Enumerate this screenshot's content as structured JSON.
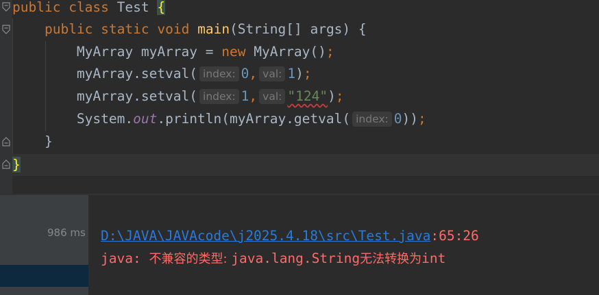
{
  "editor": {
    "line1": {
      "kw1": "public",
      "kw2": "class",
      "name": "Test",
      "brace": "{"
    },
    "line2": {
      "kw1": "public",
      "kw2": "static",
      "kw3": "void",
      "method": "main",
      "params": "(String[] args) {"
    },
    "line3": {
      "type": "MyArray myArray = ",
      "kw": "new",
      "ctor": " MyArray()",
      "semi": ";"
    },
    "line4": {
      "call": "myArray.setval(",
      "hint_index": "index:",
      "arg1": "0",
      "comma": ",",
      "hint_val": "val:",
      "arg2": "1",
      "close": ")",
      "semi": ";"
    },
    "line5": {
      "call": "myArray.setval(",
      "hint_index": "index:",
      "arg1": "1",
      "comma": ",",
      "hint_val": "val:",
      "arg2": "\"124\"",
      "close": ")",
      "semi": ";"
    },
    "line6": {
      "sys": "System.",
      "field": "out",
      "println": ".println(myArray.getval(",
      "hint_index": "index:",
      "arg1": "0",
      "close": "))",
      "semi": ";"
    },
    "line7": {
      "brace": "}"
    },
    "line8": {
      "brace": "}"
    }
  },
  "run": {
    "time": "986 ms",
    "path_link": "D:\\JAVA\\JAVAcode\\j2025.4.18\\src\\Test.java",
    "path_pos": ":65:26",
    "error_prefix": "java: ",
    "error_cjk1": "不兼容的类型: ",
    "error_type": "java.lang.String",
    "error_cjk2": "无法转换为",
    "error_suffix": "int"
  },
  "colors": {
    "background": "#2b2b2b",
    "keyword": "#cc7832",
    "method": "#ffc66d",
    "number": "#6897bb",
    "string": "#6a8759",
    "link": "#287bde",
    "error": "#ff6b68"
  }
}
